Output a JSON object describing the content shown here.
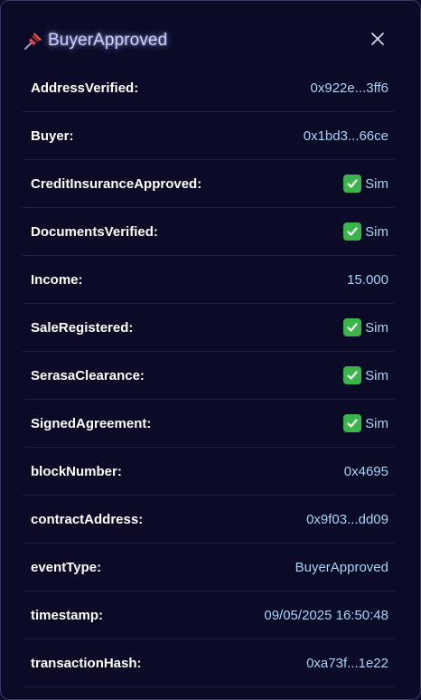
{
  "header": {
    "icon": "pushpin-icon",
    "title": "BuyerApproved"
  },
  "close_icon": "close-icon",
  "colors": {
    "background": "#0b0b28",
    "label": "#ffffff",
    "value": "#a5d6f5",
    "check": "#39b54a"
  },
  "rows": [
    {
      "label": "AddressVerified:",
      "value": "0x922e...3ff6"
    },
    {
      "label": "Buyer:",
      "value": "0x1bd3...66ce"
    },
    {
      "label": "CreditInsuranceApproved:",
      "value": "Sim",
      "icon": "check-mark-icon"
    },
    {
      "label": "DocumentsVerified:",
      "value": "Sim",
      "icon": "check-mark-icon"
    },
    {
      "label": "Income:",
      "value": "15.000"
    },
    {
      "label": "SaleRegistered:",
      "value": "Sim",
      "icon": "check-mark-icon"
    },
    {
      "label": "SerasaClearance:",
      "value": "Sim",
      "icon": "check-mark-icon"
    },
    {
      "label": "SignedAgreement:",
      "value": "Sim",
      "icon": "check-mark-icon"
    },
    {
      "label": "blockNumber:",
      "value": "0x4695"
    },
    {
      "label": "contractAddress:",
      "value": "0x9f03...dd09"
    },
    {
      "label": "eventType:",
      "value": "BuyerApproved"
    },
    {
      "label": "timestamp:",
      "value": "09/05/2025 16:50:48"
    },
    {
      "label": "transactionHash:",
      "value": "0xa73f...1e22"
    }
  ]
}
